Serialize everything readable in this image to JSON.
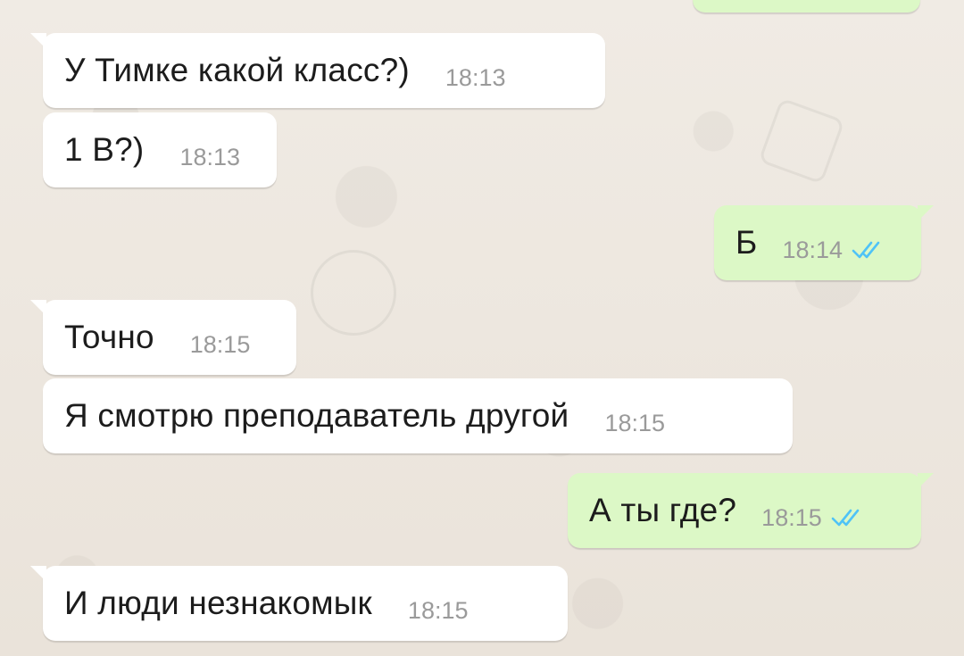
{
  "chat": {
    "messages": [
      {
        "text": "У Тимке какой класс?)",
        "time": "18:13",
        "direction": "incoming"
      },
      {
        "text": "1 В?)",
        "time": "18:13",
        "direction": "incoming"
      },
      {
        "text": "Б",
        "time": "18:14",
        "direction": "outgoing",
        "status_icon": "double-check-icon"
      },
      {
        "text": "Точно",
        "time": "18:15",
        "direction": "incoming"
      },
      {
        "text": "Я смотрю преподаватель другой",
        "time": "18:15",
        "direction": "incoming"
      },
      {
        "text": "А ты где?",
        "time": "18:15",
        "direction": "outgoing",
        "status_icon": "double-check-icon"
      },
      {
        "text": "И люди незнакомык",
        "time": "18:15",
        "direction": "incoming"
      }
    ]
  },
  "colors": {
    "background": "#ece5dd",
    "incoming_bubble": "#ffffff",
    "outgoing_bubble": "#dcf8c6",
    "read_ticks": "#4fc3f7",
    "timestamp": "#9a9a9a"
  }
}
